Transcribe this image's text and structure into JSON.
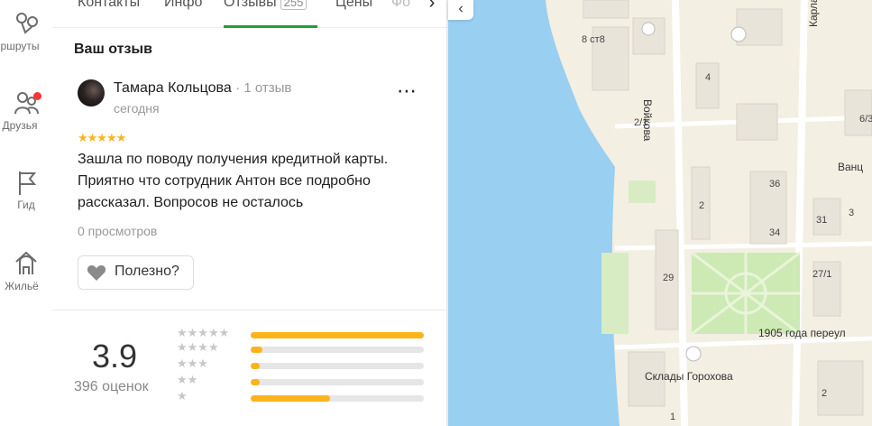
{
  "rail": {
    "items": [
      {
        "label": "ршруты",
        "icon": "route-icon"
      },
      {
        "label": "Друзья",
        "icon": "friends-icon"
      },
      {
        "label": "Гид",
        "icon": "flag-icon"
      },
      {
        "label": "Жильё",
        "icon": "housing-icon"
      }
    ]
  },
  "tabs": {
    "items": [
      {
        "label": "Контакты"
      },
      {
        "label": "Инфо"
      },
      {
        "label": "Отзывы",
        "count": "255"
      },
      {
        "label": "Цены"
      },
      {
        "label": "Фо"
      }
    ],
    "active": "Отзывы",
    "more_icon": "chevron-right-icon"
  },
  "review": {
    "title": "Ваш отзыв",
    "author": "Тамара Кольцова",
    "author_reviews": "1 отзыв",
    "date": "сегодня",
    "rating": 5,
    "stars_text": "★★★★★",
    "more": "⋯",
    "text": "Зашла по поводу получения кредитной карты. Приятно что сотрудник Антон все подробно рассказал. Вопросов не осталось",
    "views": "0 просмотров",
    "useful_label": "Полезно?"
  },
  "summary": {
    "score": "3.9",
    "count_label": "396 оценок",
    "distribution": [
      {
        "stars": "★★★★★",
        "fraction": 1.0
      },
      {
        "stars": "★★★★",
        "fraction": 0.07
      },
      {
        "stars": "★★★",
        "fraction": 0.05
      },
      {
        "stars": "★★",
        "fraction": 0.05
      },
      {
        "stars": "★",
        "fraction": 0.46
      }
    ]
  },
  "map": {
    "labels": [
      "8 ст8",
      "2/1",
      "Войкова",
      "Карла Маркса",
      "6/3",
      "Ванц",
      "36",
      "34",
      "31",
      "2",
      "29",
      "27/1",
      "1905 года переул",
      "Склады Горохова",
      "4",
      "3",
      "2",
      "1"
    ],
    "colors": {
      "water": "#99cff0",
      "land": "#f3efe3",
      "building": "#e8e4da",
      "park": "#cde9b4",
      "accent": "#fcb41a",
      "active_tab": "#20a134"
    }
  }
}
